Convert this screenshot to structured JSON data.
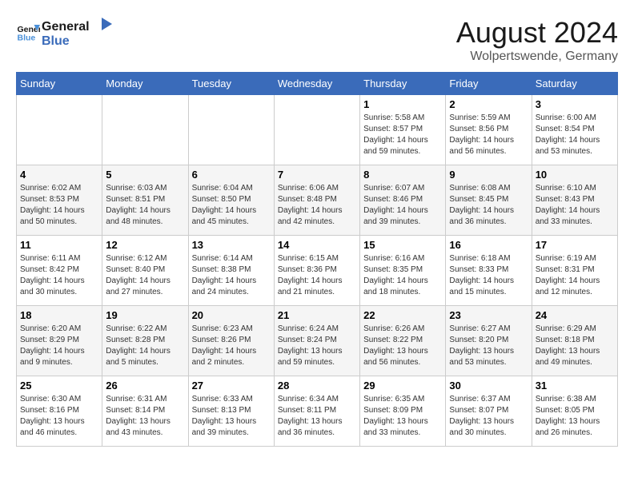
{
  "logo": {
    "line1": "General",
    "line2": "Blue"
  },
  "title": "August 2024",
  "location": "Wolpertswende, Germany",
  "weekdays": [
    "Sunday",
    "Monday",
    "Tuesday",
    "Wednesday",
    "Thursday",
    "Friday",
    "Saturday"
  ],
  "weeks": [
    [
      {
        "day": "",
        "info": ""
      },
      {
        "day": "",
        "info": ""
      },
      {
        "day": "",
        "info": ""
      },
      {
        "day": "",
        "info": ""
      },
      {
        "day": "1",
        "info": "Sunrise: 5:58 AM\nSunset: 8:57 PM\nDaylight: 14 hours\nand 59 minutes."
      },
      {
        "day": "2",
        "info": "Sunrise: 5:59 AM\nSunset: 8:56 PM\nDaylight: 14 hours\nand 56 minutes."
      },
      {
        "day": "3",
        "info": "Sunrise: 6:00 AM\nSunset: 8:54 PM\nDaylight: 14 hours\nand 53 minutes."
      }
    ],
    [
      {
        "day": "4",
        "info": "Sunrise: 6:02 AM\nSunset: 8:53 PM\nDaylight: 14 hours\nand 50 minutes."
      },
      {
        "day": "5",
        "info": "Sunrise: 6:03 AM\nSunset: 8:51 PM\nDaylight: 14 hours\nand 48 minutes."
      },
      {
        "day": "6",
        "info": "Sunrise: 6:04 AM\nSunset: 8:50 PM\nDaylight: 14 hours\nand 45 minutes."
      },
      {
        "day": "7",
        "info": "Sunrise: 6:06 AM\nSunset: 8:48 PM\nDaylight: 14 hours\nand 42 minutes."
      },
      {
        "day": "8",
        "info": "Sunrise: 6:07 AM\nSunset: 8:46 PM\nDaylight: 14 hours\nand 39 minutes."
      },
      {
        "day": "9",
        "info": "Sunrise: 6:08 AM\nSunset: 8:45 PM\nDaylight: 14 hours\nand 36 minutes."
      },
      {
        "day": "10",
        "info": "Sunrise: 6:10 AM\nSunset: 8:43 PM\nDaylight: 14 hours\nand 33 minutes."
      }
    ],
    [
      {
        "day": "11",
        "info": "Sunrise: 6:11 AM\nSunset: 8:42 PM\nDaylight: 14 hours\nand 30 minutes."
      },
      {
        "day": "12",
        "info": "Sunrise: 6:12 AM\nSunset: 8:40 PM\nDaylight: 14 hours\nand 27 minutes."
      },
      {
        "day": "13",
        "info": "Sunrise: 6:14 AM\nSunset: 8:38 PM\nDaylight: 14 hours\nand 24 minutes."
      },
      {
        "day": "14",
        "info": "Sunrise: 6:15 AM\nSunset: 8:36 PM\nDaylight: 14 hours\nand 21 minutes."
      },
      {
        "day": "15",
        "info": "Sunrise: 6:16 AM\nSunset: 8:35 PM\nDaylight: 14 hours\nand 18 minutes."
      },
      {
        "day": "16",
        "info": "Sunrise: 6:18 AM\nSunset: 8:33 PM\nDaylight: 14 hours\nand 15 minutes."
      },
      {
        "day": "17",
        "info": "Sunrise: 6:19 AM\nSunset: 8:31 PM\nDaylight: 14 hours\nand 12 minutes."
      }
    ],
    [
      {
        "day": "18",
        "info": "Sunrise: 6:20 AM\nSunset: 8:29 PM\nDaylight: 14 hours\nand 9 minutes."
      },
      {
        "day": "19",
        "info": "Sunrise: 6:22 AM\nSunset: 8:28 PM\nDaylight: 14 hours\nand 5 minutes."
      },
      {
        "day": "20",
        "info": "Sunrise: 6:23 AM\nSunset: 8:26 PM\nDaylight: 14 hours\nand 2 minutes."
      },
      {
        "day": "21",
        "info": "Sunrise: 6:24 AM\nSunset: 8:24 PM\nDaylight: 13 hours\nand 59 minutes."
      },
      {
        "day": "22",
        "info": "Sunrise: 6:26 AM\nSunset: 8:22 PM\nDaylight: 13 hours\nand 56 minutes."
      },
      {
        "day": "23",
        "info": "Sunrise: 6:27 AM\nSunset: 8:20 PM\nDaylight: 13 hours\nand 53 minutes."
      },
      {
        "day": "24",
        "info": "Sunrise: 6:29 AM\nSunset: 8:18 PM\nDaylight: 13 hours\nand 49 minutes."
      }
    ],
    [
      {
        "day": "25",
        "info": "Sunrise: 6:30 AM\nSunset: 8:16 PM\nDaylight: 13 hours\nand 46 minutes."
      },
      {
        "day": "26",
        "info": "Sunrise: 6:31 AM\nSunset: 8:14 PM\nDaylight: 13 hours\nand 43 minutes."
      },
      {
        "day": "27",
        "info": "Sunrise: 6:33 AM\nSunset: 8:13 PM\nDaylight: 13 hours\nand 39 minutes."
      },
      {
        "day": "28",
        "info": "Sunrise: 6:34 AM\nSunset: 8:11 PM\nDaylight: 13 hours\nand 36 minutes."
      },
      {
        "day": "29",
        "info": "Sunrise: 6:35 AM\nSunset: 8:09 PM\nDaylight: 13 hours\nand 33 minutes."
      },
      {
        "day": "30",
        "info": "Sunrise: 6:37 AM\nSunset: 8:07 PM\nDaylight: 13 hours\nand 30 minutes."
      },
      {
        "day": "31",
        "info": "Sunrise: 6:38 AM\nSunset: 8:05 PM\nDaylight: 13 hours\nand 26 minutes."
      }
    ]
  ]
}
